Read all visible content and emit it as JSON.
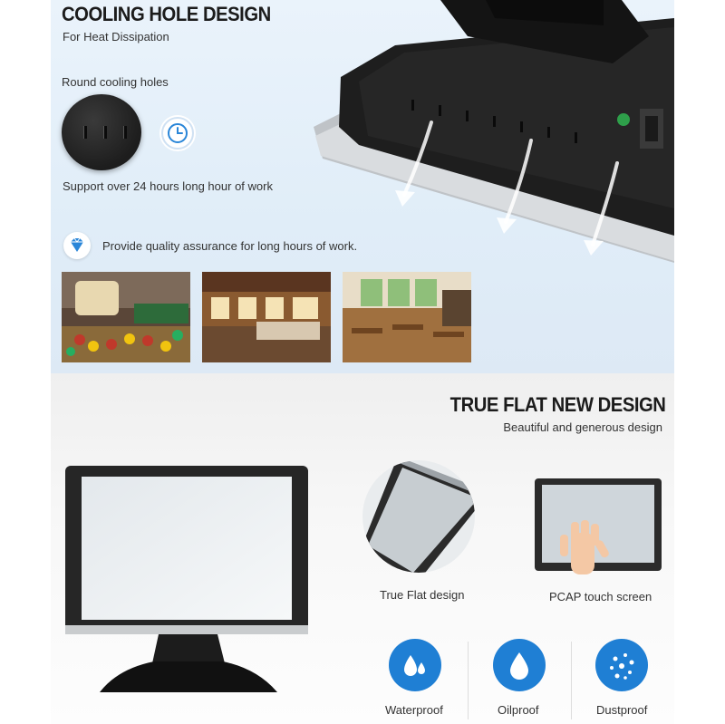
{
  "cooling": {
    "title": "COOLING HOLE DESIGN",
    "subtitle": "For Heat Dissipation",
    "holes_label": "Round cooling holes",
    "support_text": "Support over 24 hours long hour of work",
    "quality_text": "Provide quality assurance for long hours of work."
  },
  "flat": {
    "title": "TRUE FLAT NEW DESIGN",
    "subtitle": "Beautiful and generous design",
    "flat_caption": "True Flat design",
    "pcap_caption": "PCAP touch screen"
  },
  "features": [
    {
      "label": "Waterproof",
      "icon": "water-drops-icon"
    },
    {
      "label": "Oilproof",
      "icon": "oil-drop-icon"
    },
    {
      "label": "Dustproof",
      "icon": "dust-dots-icon"
    }
  ],
  "colors": {
    "accent_blue": "#1f7fd4",
    "top_bg": "#e4eff9",
    "bottom_bg": "#f3f3f3"
  }
}
